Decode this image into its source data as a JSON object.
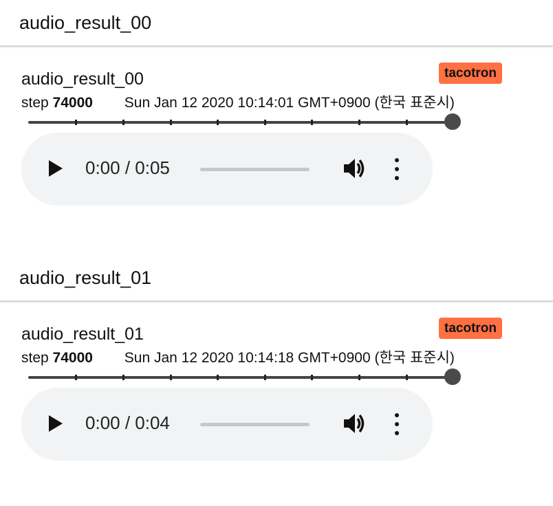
{
  "cards": [
    {
      "section_title": "audio_result_00",
      "title": "audio_result_00",
      "badge": "tacotron",
      "step_label": "step",
      "step_value": "74000",
      "timestamp": "Sun Jan 12 2020 10:14:01 GMT+0900 (한국 표준시)",
      "player": {
        "time": "0:00 / 0:05",
        "play_icon": "play-icon",
        "volume_icon": "volume-icon",
        "menu_icon": "more-vert-icon"
      }
    },
    {
      "section_title": "audio_result_01",
      "title": "audio_result_01",
      "badge": "tacotron",
      "step_label": "step",
      "step_value": "74000",
      "timestamp": "Sun Jan 12 2020 10:14:18 GMT+0900 (한국 표준시)",
      "player": {
        "time": "0:00 / 0:04",
        "play_icon": "play-icon",
        "volume_icon": "volume-icon",
        "menu_icon": "more-vert-icon"
      }
    }
  ],
  "colors": {
    "badge": "#ff7043",
    "player_bg": "#f1f3f4",
    "slider": "#444444"
  }
}
